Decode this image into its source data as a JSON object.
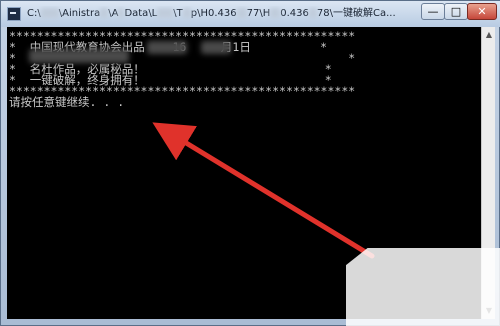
{
  "window": {
    "title_parts": {
      "p1": "C:\\",
      "p2": "\\A",
      "p3": "inistra",
      "p4": "\\A",
      "p5": "Data\\L",
      "p6": "\\T",
      "p7": "p\\H",
      "p8": "0.436",
      "p9": "77\\H",
      "p10": "0.436",
      "p11": "78\\一键破解Ca..."
    },
    "controls": {
      "minimize": "—",
      "maximize": "□",
      "close": "✕"
    }
  },
  "console": {
    "lines": [
      "**************************************************",
      "*  中国现代教育协会出品    16     月1日          *",
      "*                                                *",
      "*  名杜作品，必属秘品！                          *",
      "*  一键破解，终身拥有！                          *",
      "**************************************************",
      "请按任意键继续. . ."
    ]
  },
  "scrollbar": {
    "up": "▲",
    "down": "▼"
  },
  "colors": {
    "arrow": "#e0322b",
    "console_bg": "#000000",
    "console_text": "#c8c8c8"
  },
  "icons": {
    "app": "console-window-icon",
    "arrow": "red-arrow-annotation"
  }
}
